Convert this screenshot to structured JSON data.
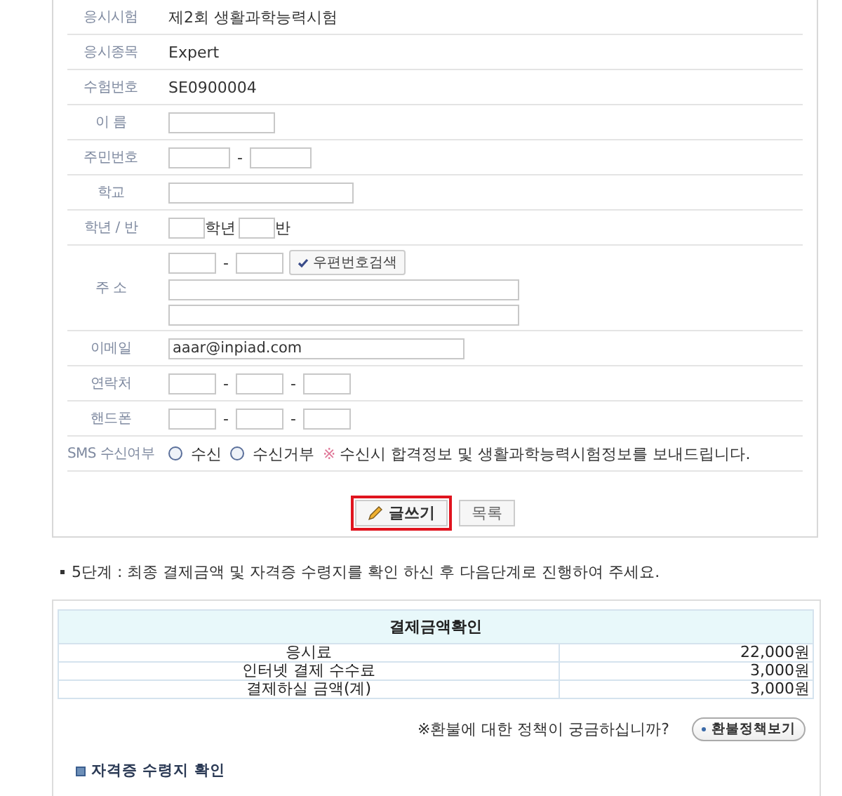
{
  "form": {
    "rows": [
      {
        "label": "응시시험",
        "kind": "text",
        "value": "제2회 생활과학능력시험"
      },
      {
        "label": "응시종목",
        "kind": "text",
        "value": "Expert"
      },
      {
        "label": "수험번호",
        "kind": "text",
        "value": "SE0900004"
      },
      {
        "label": "이 름",
        "kind": "name"
      },
      {
        "label": "주민번호",
        "kind": "id_number",
        "separators": [
          "-"
        ]
      },
      {
        "label": "학교",
        "kind": "school"
      },
      {
        "label": "학년 / 반",
        "kind": "grade",
        "units": [
          "학년",
          "반"
        ]
      },
      {
        "label": "주 소",
        "kind": "address",
        "separators": [
          "-"
        ],
        "button": "우편번호검색"
      },
      {
        "label": "이메일",
        "kind": "email",
        "value": "aaar@inpiad.com"
      },
      {
        "label": "연락처",
        "kind": "phone",
        "separators": [
          "-",
          "-"
        ]
      },
      {
        "label": "핸드폰",
        "kind": "phone",
        "separators": [
          "-",
          "-"
        ]
      },
      {
        "label": "SMS 수신여부",
        "kind": "sms",
        "options": [
          {
            "label": "수신",
            "selected": false
          },
          {
            "label": "수신거부",
            "selected": false
          }
        ],
        "note_mark": "※",
        "note": "수신시 합격정보 및 생활과학능력시험정보를 보내드립니다."
      }
    ],
    "buttons": [
      {
        "label": "글쓰기",
        "highlighted": true
      },
      {
        "label": "목록",
        "highlighted": false
      }
    ]
  },
  "step_text": "5단계 : 최종 결제금액 및 자격증 수령지를 확인 하신 후 다음단계로 진행하여 주세요.",
  "payment": {
    "title": "결제금액확인",
    "rows": [
      {
        "item": "응시료",
        "amount": "22,000원"
      },
      {
        "item": "인터넷 결제 수수료",
        "amount": "3,000원"
      },
      {
        "item": "결제하실 금액(계)",
        "amount": "3,000원"
      }
    ],
    "refund_note": "※환불에 대한 정책이 궁금하십니까?",
    "refund_button": "환불정책보기"
  },
  "section_heading": "자격증 수령지 확인"
}
